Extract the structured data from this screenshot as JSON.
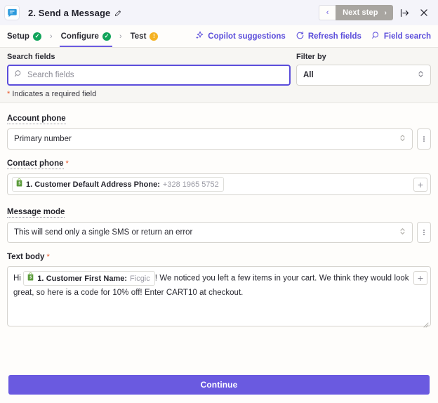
{
  "titlebar": {
    "app_icon": "chat-bubble-icon",
    "title": "2. Send a Message",
    "edit_icon": "pencil-icon",
    "prev_label": "‹",
    "next_step_label": "Next step",
    "next_step_chevron": "›",
    "expand_icon": "collapse-panel-icon",
    "close_icon": "close-icon",
    "next_step_color": "#A8A5A0"
  },
  "steps": {
    "items": [
      {
        "label": "Setup",
        "status": "complete",
        "badge": "✓"
      },
      {
        "label": "Configure",
        "status": "complete",
        "badge": "✓"
      },
      {
        "label": "Test",
        "status": "warning",
        "badge": "!"
      }
    ],
    "separator": "›",
    "active_index": 1,
    "actions": [
      {
        "label": "Copilot suggestions",
        "icon": "sparkle-icon"
      },
      {
        "label": "Refresh fields",
        "icon": "refresh-icon"
      },
      {
        "label": "Field search",
        "icon": "search-icon"
      }
    ],
    "accent_color": "#5b4ddb"
  },
  "search_strip": {
    "search_label": "Search fields",
    "search_placeholder": "Search fields",
    "search_value": "",
    "search_icon": "search-icon",
    "filter_label": "Filter by",
    "filter_value": "All",
    "required_star": "*",
    "required_note": "Indicates a required field",
    "focus_color": "#5b4ddb"
  },
  "form": {
    "groups": [
      {
        "label": "Account phone",
        "required": false,
        "type": "select",
        "value": "Primary number",
        "has_kebab": true
      },
      {
        "label": "Contact phone",
        "required": true,
        "type": "token",
        "token": {
          "icon": "shopify-bag-icon",
          "name": "1. Customer Default Address Phone:",
          "value": "+328 1965 5752"
        },
        "add_label": "+"
      },
      {
        "label": "Message mode",
        "required": false,
        "type": "select",
        "value": "This will send only a single SMS or return an error",
        "has_kebab": true
      },
      {
        "label": "Text body",
        "required": true,
        "type": "textarea",
        "prefix_text": "Hi",
        "token": {
          "icon": "shopify-bag-icon",
          "name": "1. Customer First Name:",
          "value": "Ficgic"
        },
        "suffix_text": "! We noticed you left a few items in your cart. We think they would look great, so here is a code for 10% off! Enter CART10 at checkout.",
        "add_label": "+"
      }
    ],
    "required_star": "*"
  },
  "footer": {
    "continue_label": "Continue",
    "continue_color": "#6a5ae0"
  }
}
